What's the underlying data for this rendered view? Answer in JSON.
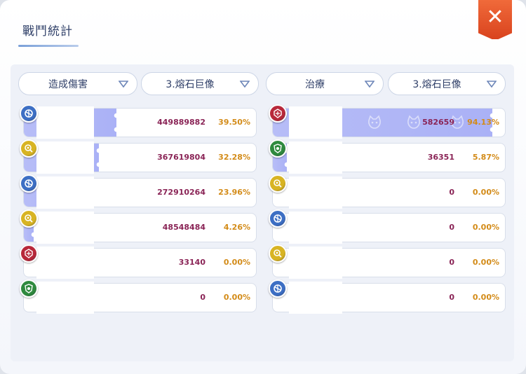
{
  "title": "戰鬥統計",
  "close_label": "✕",
  "left": {
    "category": "造成傷害",
    "target": "3.熔石巨像",
    "rows": [
      {
        "value": "449889882",
        "percent": "39.50%",
        "fill": 0.395,
        "icon": "blue-swirl-icon",
        "color": "#3d6fc4"
      },
      {
        "value": "367619804",
        "percent": "32.28%",
        "fill": 0.3228,
        "icon": "yellow-eye-icon",
        "color": "#d8b423"
      },
      {
        "value": "272910264",
        "percent": "23.96%",
        "fill": 0.2396,
        "icon": "blue-swirl-icon",
        "color": "#3d6fc4"
      },
      {
        "value": "48548484",
        "percent": "4.26%",
        "fill": 0.0426,
        "icon": "yellow-eye-icon",
        "color": "#d8b423"
      },
      {
        "value": "33140",
        "percent": "0.00%",
        "fill": 0,
        "icon": "red-crest-icon",
        "color": "#b8283a"
      },
      {
        "value": "0",
        "percent": "0.00%",
        "fill": 0,
        "icon": "green-crest-icon",
        "color": "#2f8a3e"
      }
    ]
  },
  "right": {
    "category": "治療",
    "target": "3.熔石巨像",
    "rows": [
      {
        "value": "582659",
        "percent": "94.13%",
        "fill": 0.9413,
        "icon": "red-crest-icon",
        "color": "#b8283a"
      },
      {
        "value": "36351",
        "percent": "5.87%",
        "fill": 0.0587,
        "icon": "green-crest-icon",
        "color": "#2f8a3e"
      },
      {
        "value": "0",
        "percent": "0.00%",
        "fill": 0,
        "icon": "yellow-eye-icon",
        "color": "#d8b423"
      },
      {
        "value": "0",
        "percent": "0.00%",
        "fill": 0,
        "icon": "blue-swirl-icon",
        "color": "#3d6fc4"
      },
      {
        "value": "0",
        "percent": "0.00%",
        "fill": 0,
        "icon": "yellow-eye-icon",
        "color": "#d8b423"
      },
      {
        "value": "0",
        "percent": "0.00%",
        "fill": 0,
        "icon": "blue-swirl-icon",
        "color": "#3d6fc4"
      }
    ]
  }
}
